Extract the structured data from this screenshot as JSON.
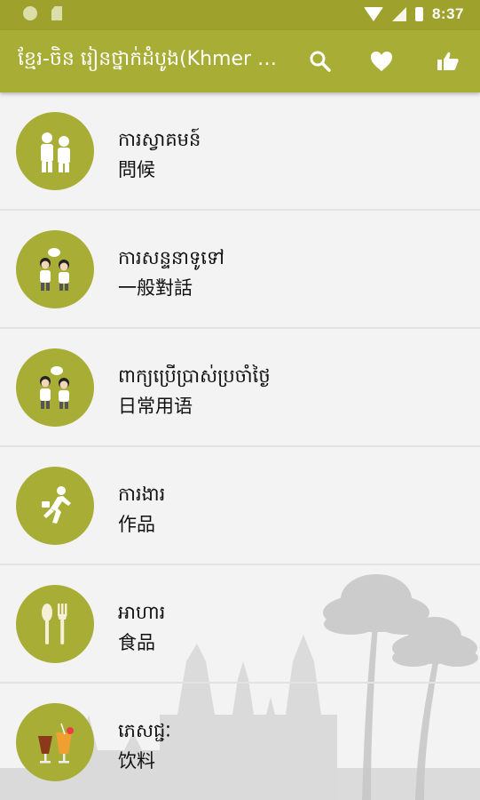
{
  "status_bar": {
    "time": "8:37"
  },
  "app_bar": {
    "title": "ខ្មែរ-ចិន រៀនថ្នាក់ដំបូង(Khmer C..."
  },
  "colors": {
    "accent": "#a8ad36",
    "statusbar": "#9ea22d",
    "list_bg": "#f3f3f3"
  },
  "categories": [
    {
      "khmer": "ការស្វាគមន៍",
      "chinese": "問候",
      "icon": "greeting-people-icon"
    },
    {
      "khmer": "ការសន្ទនាទូទៅ",
      "chinese": "一般對話",
      "icon": "conversation-icon"
    },
    {
      "khmer": "ពាក្យប្រើប្រាស់ប្រចាំថ្ងៃ",
      "chinese": "日常用语",
      "icon": "daily-talk-icon"
    },
    {
      "khmer": "ការងារ",
      "chinese": "作品",
      "icon": "work-runner-icon"
    },
    {
      "khmer": "អាហារ",
      "chinese": "食品",
      "icon": "spoon-fork-icon"
    },
    {
      "khmer": "ភេសជ្ជៈ",
      "chinese": "饮料",
      "icon": "drinks-icon"
    }
  ]
}
